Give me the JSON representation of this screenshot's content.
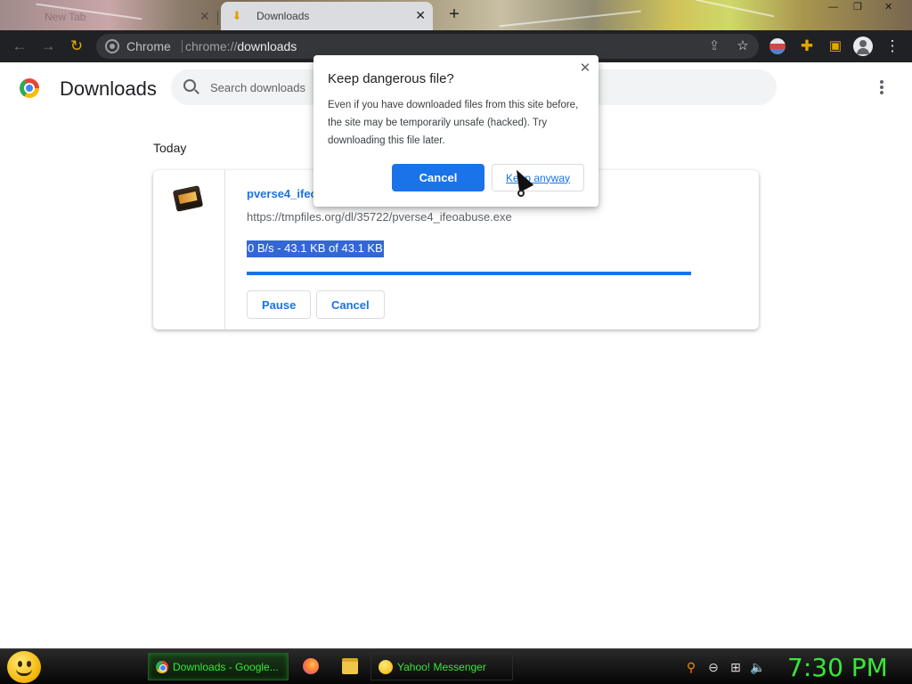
{
  "browser": {
    "tabs": [
      {
        "label": "New Tab",
        "active": false
      },
      {
        "label": "Downloads",
        "active": true
      }
    ],
    "omnibox": {
      "scheme_label": "Chrome",
      "url_prefix": "chrome://",
      "url_path": "downloads"
    },
    "icons": {
      "back": "back-arrow-icon",
      "forward": "forward-arrow-icon",
      "reload": "reload-icon",
      "share": "share-icon",
      "bookmark": "star-icon",
      "extensions": "puzzle-icon",
      "sidepanel": "side-panel-icon",
      "profile": "profile-icon",
      "menu": "kebab-menu-icon"
    }
  },
  "downloads_page": {
    "title": "Downloads",
    "search": {
      "placeholder": "Search downloads",
      "value": ""
    },
    "section_label": "Today",
    "items": [
      {
        "file_name": "pverse4_ifeo",
        "url": "https://tmpfiles.org/dl/35722/pverse4_ifeoabuse.exe",
        "status": "0 B/s - 43.1 KB of 43.1 KB",
        "progress": 1.0,
        "actions": [
          "Pause",
          "Cancel"
        ]
      }
    ]
  },
  "dialog": {
    "title": "Keep dangerous file?",
    "body": "Even if you have downloaded files from this site before, the site may be temporarily unsafe (hacked). Try downloading this file later.",
    "primary_button": "Cancel",
    "secondary_button": "Keep anyway"
  },
  "taskbar": {
    "tasks": [
      {
        "label": "Downloads - Google...",
        "icon": "chrome-icon",
        "active": true
      },
      {
        "label": "Yahoo! Messenger",
        "icon": "yahoo-messenger-icon",
        "active": false
      }
    ],
    "quick_launch": [
      "firefox-icon",
      "folder-icon"
    ],
    "tray_icons": [
      "search-icon",
      "minus-circle-icon",
      "network-icon",
      "volume-icon"
    ],
    "clock": "7:30 PM"
  },
  "colors": {
    "accent": "#1a73e8",
    "toolbar_bg": "#202124",
    "taskbar_text": "#39e639"
  }
}
